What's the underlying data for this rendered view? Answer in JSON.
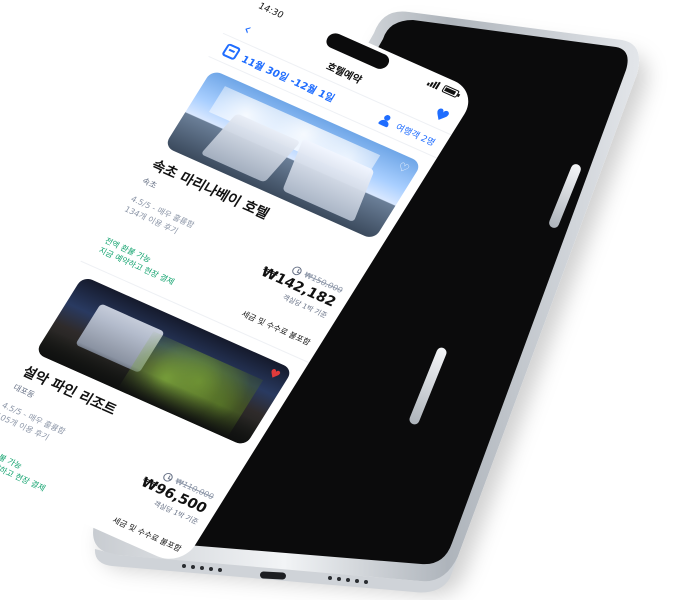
{
  "status_bar": {
    "time": "14:30"
  },
  "nav": {
    "title": "호텔예약"
  },
  "date_range": "11월 30일 -12월 1일",
  "guests": "여행객 2명",
  "colors": {
    "accent": "#1f6dff",
    "green": "#13a36f",
    "liked_heart": "#e03b3b"
  },
  "hotels": [
    {
      "name": "속초 마리나베이 호텔",
      "location": "속초",
      "rating": "4.5/5 - 매우 훌륭함",
      "reviews": "134개 이용 후기",
      "original_price": "₩150,000",
      "price": "₩142,182",
      "per_night": "객실당 1박 기준",
      "refund": "전액 환불 가능",
      "pay_later": "지금 예약하고 현장 결제",
      "taxes": "세금 및 수수료 불포함",
      "liked": false
    },
    {
      "name": "설악 파인 리조트",
      "location": "대포동",
      "rating": "4.5/5 - 매우 훌륭함",
      "reviews": "105개 이용 후기",
      "original_price": "₩110,000",
      "price": "₩96,500",
      "per_night": "객실당 1박 기준",
      "refund": "전액 환불 가능",
      "pay_later": "지금 예약하고 현장 결제",
      "taxes": "세금 및 수수료 불포함",
      "liked": true
    }
  ]
}
